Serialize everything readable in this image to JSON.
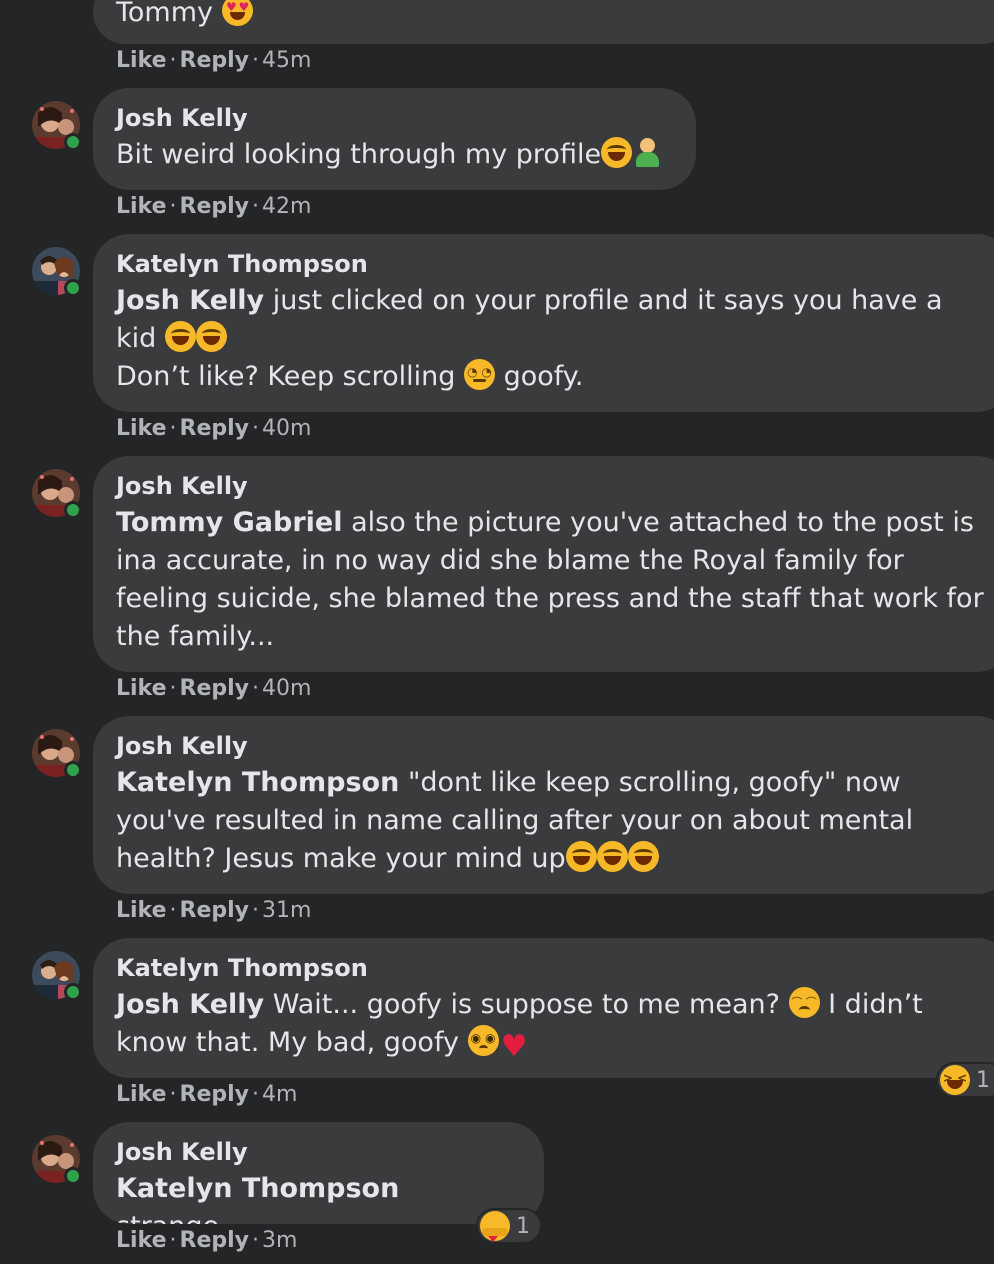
{
  "top_comment": {
    "body_text": "Tommy",
    "emoji": "heart-eyes-emoji",
    "actions": {
      "like": "Like",
      "sep": "·",
      "reply": "Reply",
      "time": "45m"
    }
  },
  "comments": [
    {
      "author": "Josh Kelly",
      "avatar": "avatar-josh-kelly",
      "online": true,
      "parts": [
        "Bit weird looking through my profile"
      ],
      "emojis": [
        "rofl-emoji",
        "facepalm-emoji"
      ],
      "actions": {
        "like": "Like",
        "reply": "Reply",
        "time": "42m"
      }
    },
    {
      "author": "Katelyn Thompson",
      "avatar": "avatar-katelyn-thompson",
      "online": true,
      "mention": "Josh Kelly",
      "line1": "just clicked on your profile and it says you have a",
      "line2": "kid",
      "line3a": "Don’t like? Keep scrolling",
      "line3b": "goofy.",
      "emojis": [
        "rofl-emoji",
        "rofl-emoji",
        "eye-roll-emoji"
      ],
      "actions": {
        "like": "Like",
        "reply": "Reply",
        "time": "40m"
      }
    },
    {
      "author": "Josh Kelly",
      "avatar": "avatar-josh-kelly",
      "online": true,
      "mention": "Tommy Gabriel",
      "text": "also the picture you've attached to the post is ina accurate, in no way did she blame the Royal family for feeling suicide, she blamed the press and the staff that work for the family...",
      "actions": {
        "like": "Like",
        "reply": "Reply",
        "time": "40m"
      }
    },
    {
      "author": "Josh Kelly",
      "avatar": "avatar-josh-kelly",
      "online": true,
      "mention": "Katelyn Thompson",
      "text": "\"dont like keep scrolling, goofy\" now you've resulted in name calling after your on about mental health? Jesus make your mind up",
      "emojis": [
        "rofl-emoji",
        "rofl-emoji",
        "rofl-emoji"
      ],
      "actions": {
        "like": "Like",
        "reply": "Reply",
        "time": "31m"
      }
    },
    {
      "author": "Katelyn Thompson",
      "avatar": "avatar-katelyn-thompson",
      "online": true,
      "mention": "Josh Kelly",
      "text_a": "Wait... goofy is suppose to me mean?",
      "text_b": "I didn’t know that. My bad, goofy",
      "emojis": [
        "disappointed-emoji",
        "pleading-emoji",
        "red-heart-emoji"
      ],
      "reaction": {
        "emoji": "squinting-laugh-emoji",
        "count": "1"
      },
      "actions": {
        "like": "Like",
        "reply": "Reply",
        "time": "4m"
      }
    },
    {
      "author": "Josh Kelly",
      "avatar": "avatar-josh-kelly",
      "online": true,
      "mention": "Katelyn Thompson",
      "text": "strange...",
      "reaction": {
        "emoji": "care-emoji",
        "count": "1"
      },
      "actions": {
        "like": "Like",
        "reply": "Reply",
        "time": "3m"
      }
    }
  ],
  "colors": {
    "background": "#242526",
    "bubble": "#3a3b3c",
    "text": "#e4e6eb",
    "meta": "#b0b3b8",
    "online": "#31a24c"
  }
}
